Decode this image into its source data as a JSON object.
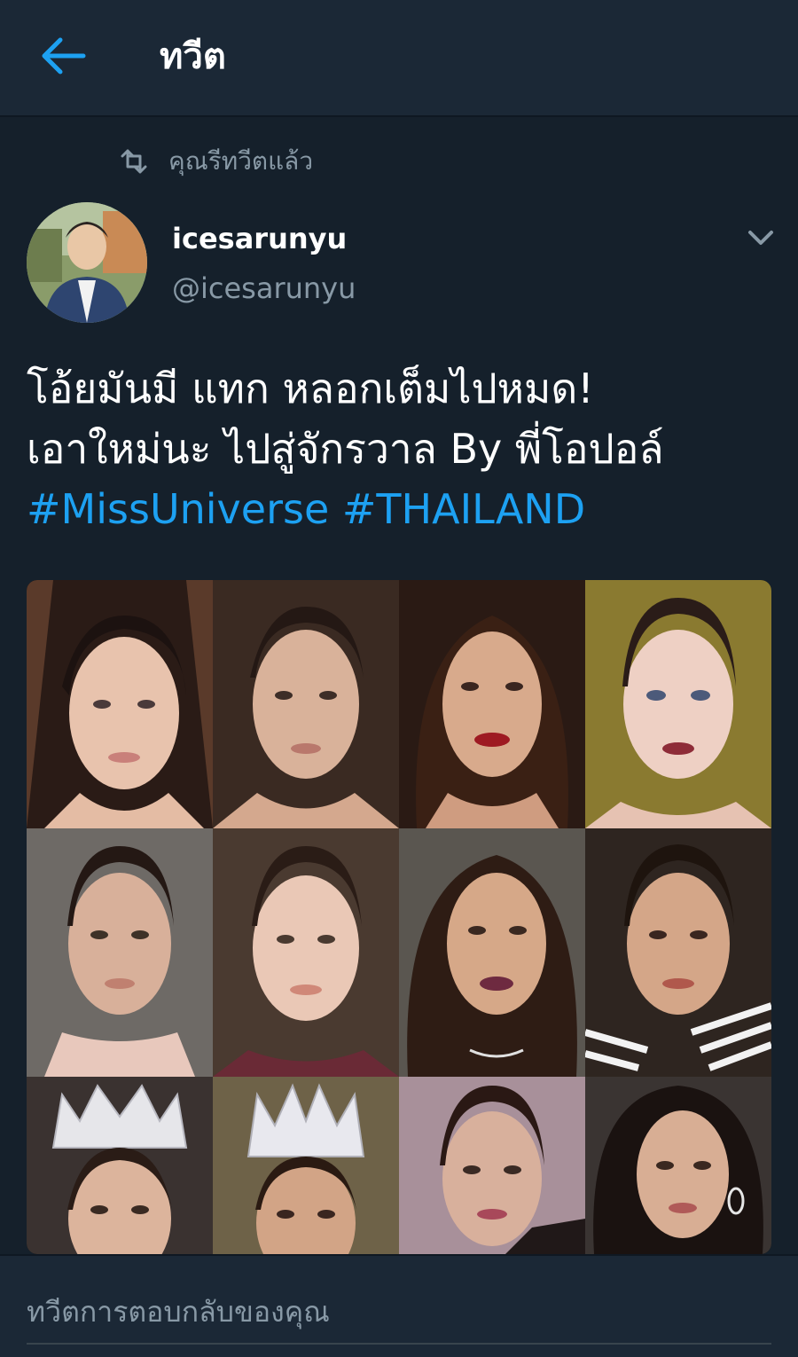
{
  "header": {
    "title": "ทวีต",
    "back_icon": "arrow-left-icon"
  },
  "retweet_notice": {
    "label": "คุณรีทวีตแล้ว",
    "icon": "retweet-icon"
  },
  "tweet": {
    "display_name": "icesarunyu",
    "handle": "@icesarunyu",
    "menu_icon": "chevron-down-icon",
    "text_line1": "โอ้ยมันมี แทก หลอกเต็มไปหมด!",
    "text_line2": "เอาใหม่นะ ไปสู่จักรวาล By พี่โอปอล์",
    "hashtag1": "#MissUniverse",
    "hashtag2": "#THAILAND"
  },
  "reply": {
    "placeholder": "ทวีตการตอบกลับของคุณ"
  },
  "colors": {
    "background": "#15202b",
    "bar": "#1b2836",
    "accent": "#1da1f2",
    "muted": "#8899a6"
  }
}
